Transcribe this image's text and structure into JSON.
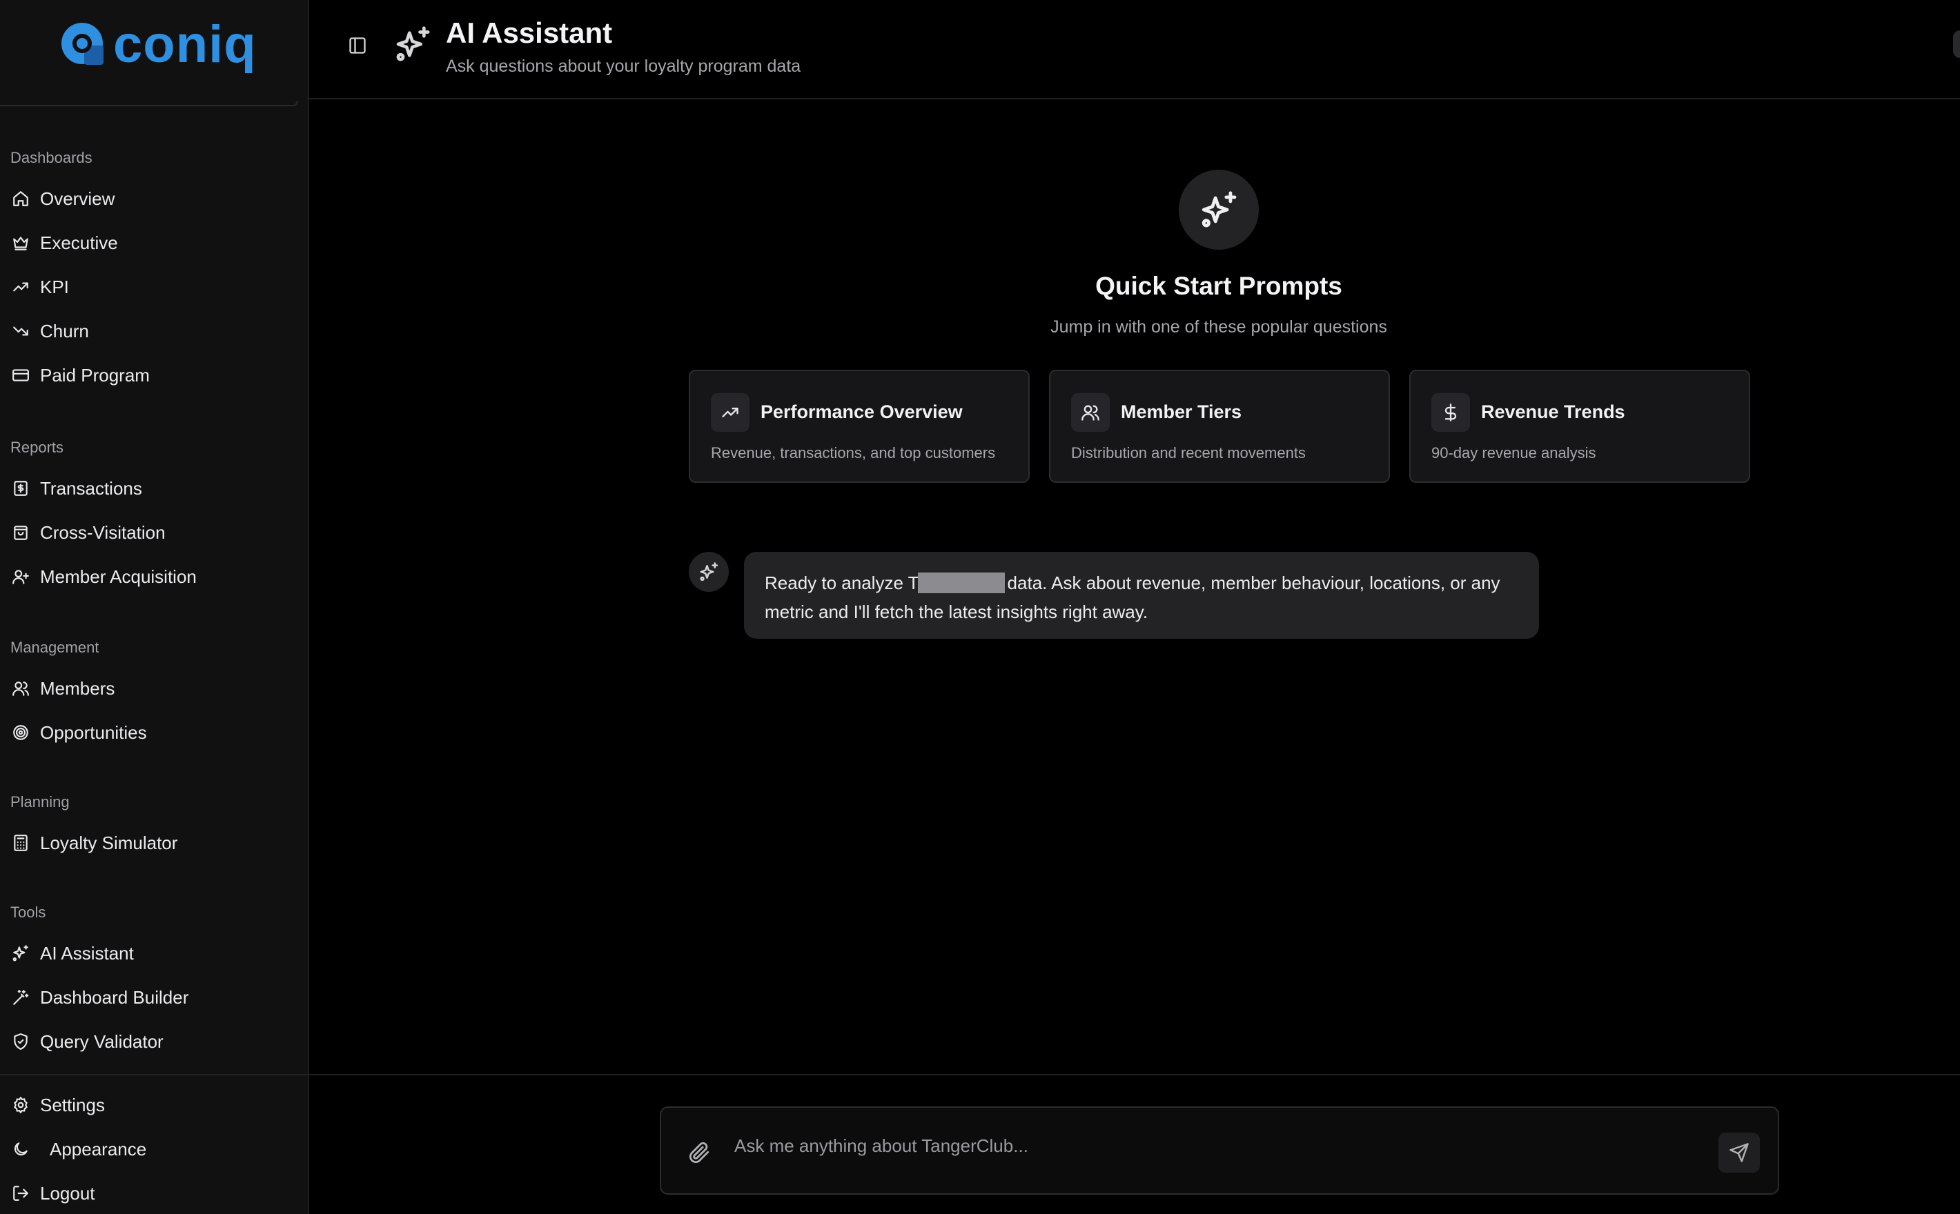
{
  "brand": {
    "name": "coniq",
    "color": "#2f8fe0"
  },
  "header": {
    "title": "AI Assistant",
    "subtitle": "Ask questions about your loyalty program data"
  },
  "sidebar": {
    "sections": {
      "dashboards": "Dashboards",
      "reports": "Reports",
      "management": "Management",
      "planning": "Planning",
      "tools": "Tools"
    },
    "items": {
      "overview": "Overview",
      "executive": "Executive",
      "kpi": "KPI",
      "churn": "Churn",
      "paid_program": "Paid Program",
      "transactions": "Transactions",
      "cross_visitation": "Cross-Visitation",
      "member_acquisition": "Member Acquisition",
      "members": "Members",
      "opportunities": "Opportunities",
      "loyalty_simulator": "Loyalty Simulator",
      "ai_assistant": "AI Assistant",
      "dashboard_builder": "Dashboard Builder",
      "query_validator": "Query Validator",
      "settings": "Settings",
      "appearance": "Appearance",
      "logout": "Logout"
    }
  },
  "quick_start": {
    "title": "Quick Start Prompts",
    "subtitle": "Jump in with one of these popular questions",
    "cards": [
      {
        "title": "Performance Overview",
        "desc": "Revenue, transactions, and top customers",
        "icon": "trending-up-icon"
      },
      {
        "title": "Member Tiers",
        "desc": "Distribution and recent movements",
        "icon": "users-icon"
      },
      {
        "title": "Revenue Trends",
        "desc": "90-day revenue analysis",
        "icon": "dollar-icon"
      }
    ]
  },
  "message": {
    "before": "Ready to analyze T",
    "after": "data. Ask about revenue, member behaviour, locations, or any metric and I'll fetch the latest insights right away."
  },
  "composer": {
    "placeholder": "Ask me anything about TangerClub..."
  }
}
